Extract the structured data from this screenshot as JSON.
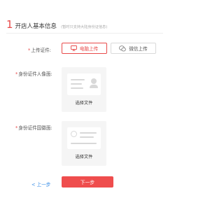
{
  "header": {
    "step_number": "1",
    "title": "开店人基本信息",
    "hint": "(暂时只支持大陆身份证信息)"
  },
  "upload": {
    "label": "上传证件:",
    "pc_button": "电脑上传",
    "wechat_button": "微信上传"
  },
  "id_front": {
    "label": "身份证件人像面:",
    "action": "选择文件"
  },
  "id_back": {
    "label": "身份证件国徽面:",
    "action": "选择文件"
  },
  "footer": {
    "prev": "上一步",
    "next": "下一步"
  },
  "colors": {
    "accent": "#e84a4a",
    "link": "#3a8ee6",
    "primary_button": "#ef4d4d"
  }
}
